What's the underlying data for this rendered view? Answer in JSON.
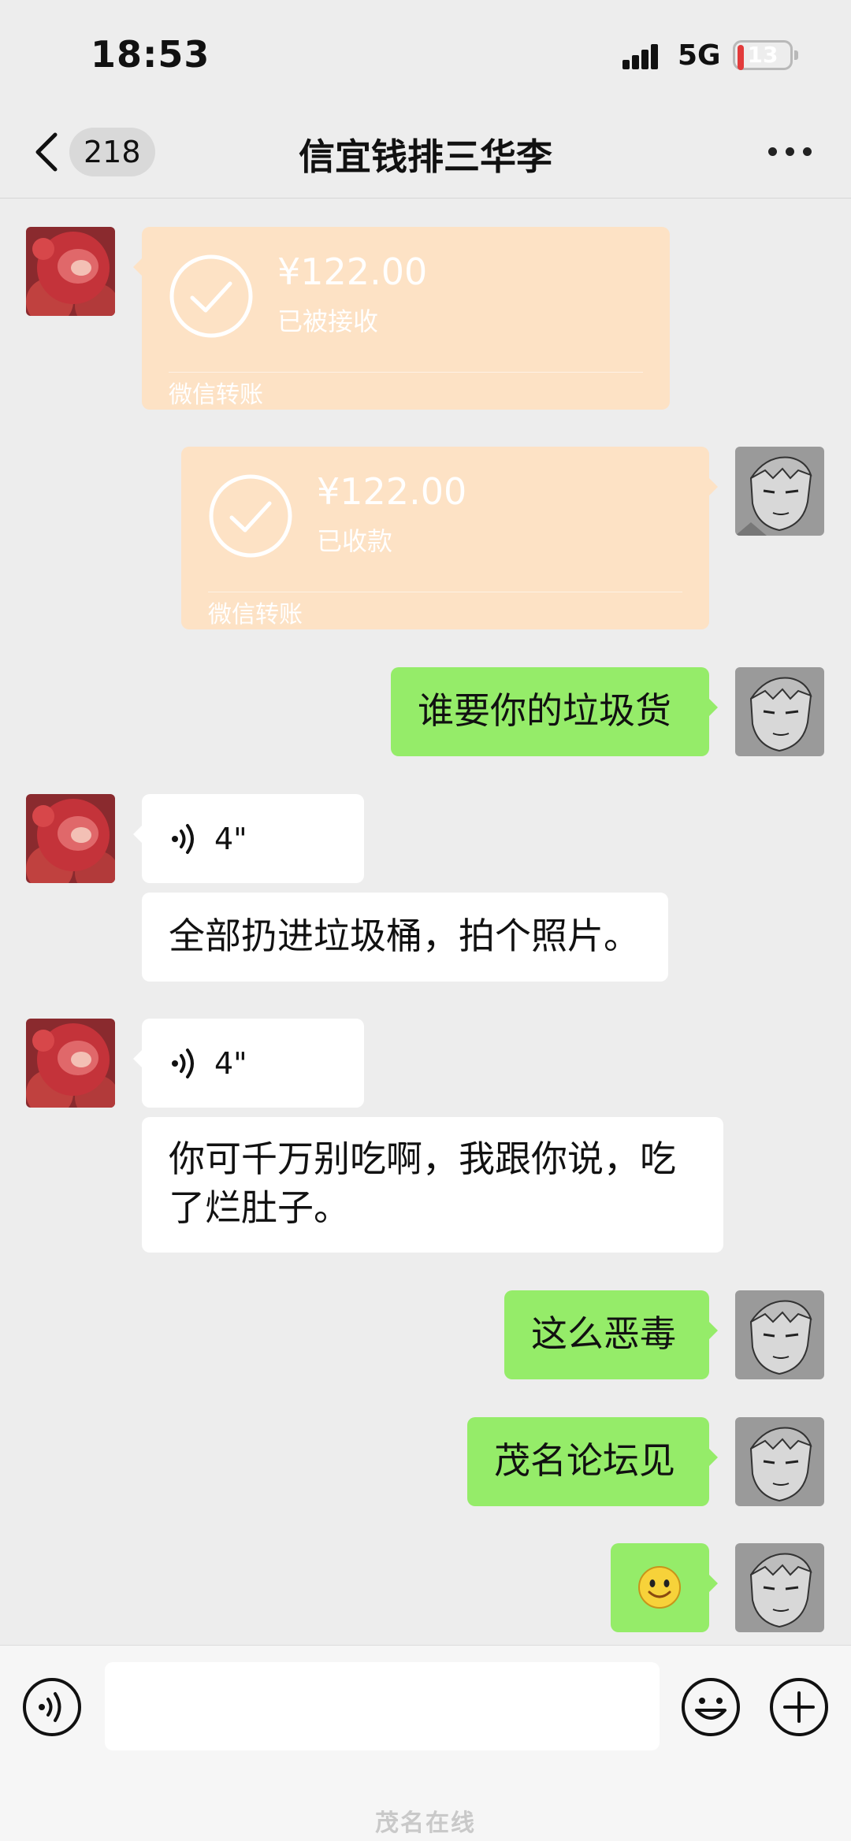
{
  "status_bar": {
    "time": "18:53",
    "network": "5G",
    "battery": "13",
    "battery_level_percent": 13
  },
  "nav": {
    "back_icon": "chevron-left-icon",
    "unread_count": "218",
    "title": "信宜钱排三华李",
    "more_icon": "more-dots-icon"
  },
  "messages": [
    {
      "side": "left",
      "type": "transfer",
      "amount": "¥122.00",
      "status": "已被接收",
      "source": "微信转账"
    },
    {
      "side": "right",
      "type": "transfer",
      "amount": "¥122.00",
      "status": "已收款",
      "source": "微信转账"
    },
    {
      "side": "right",
      "type": "text",
      "text": "谁要你的垃圾货"
    },
    {
      "side": "left",
      "type": "voice",
      "duration": "4\""
    },
    {
      "side": "left",
      "type": "text",
      "text": "全部扔进垃圾桶，拍个照片。"
    },
    {
      "side": "left",
      "type": "voice",
      "duration": "4\""
    },
    {
      "side": "left",
      "type": "text",
      "text": "你可千万别吃啊，我跟你说，吃了烂肚子。"
    },
    {
      "side": "right",
      "type": "text",
      "text": "这么恶毒"
    },
    {
      "side": "right",
      "type": "text",
      "text": "茂名论坛见"
    },
    {
      "side": "right",
      "type": "emoji",
      "emoji": "smile-emoji"
    }
  ],
  "input_bar": {
    "voice_icon": "voice-mode-icon",
    "input_value": "",
    "emoji_icon": "emoji-icon",
    "plus_icon": "plus-icon"
  },
  "watermark": "茂名在线",
  "colors": {
    "background": "#ededed",
    "bubble_green": "#95ec69",
    "bubble_white": "#ffffff",
    "transfer_orange": "#fde2c5"
  }
}
